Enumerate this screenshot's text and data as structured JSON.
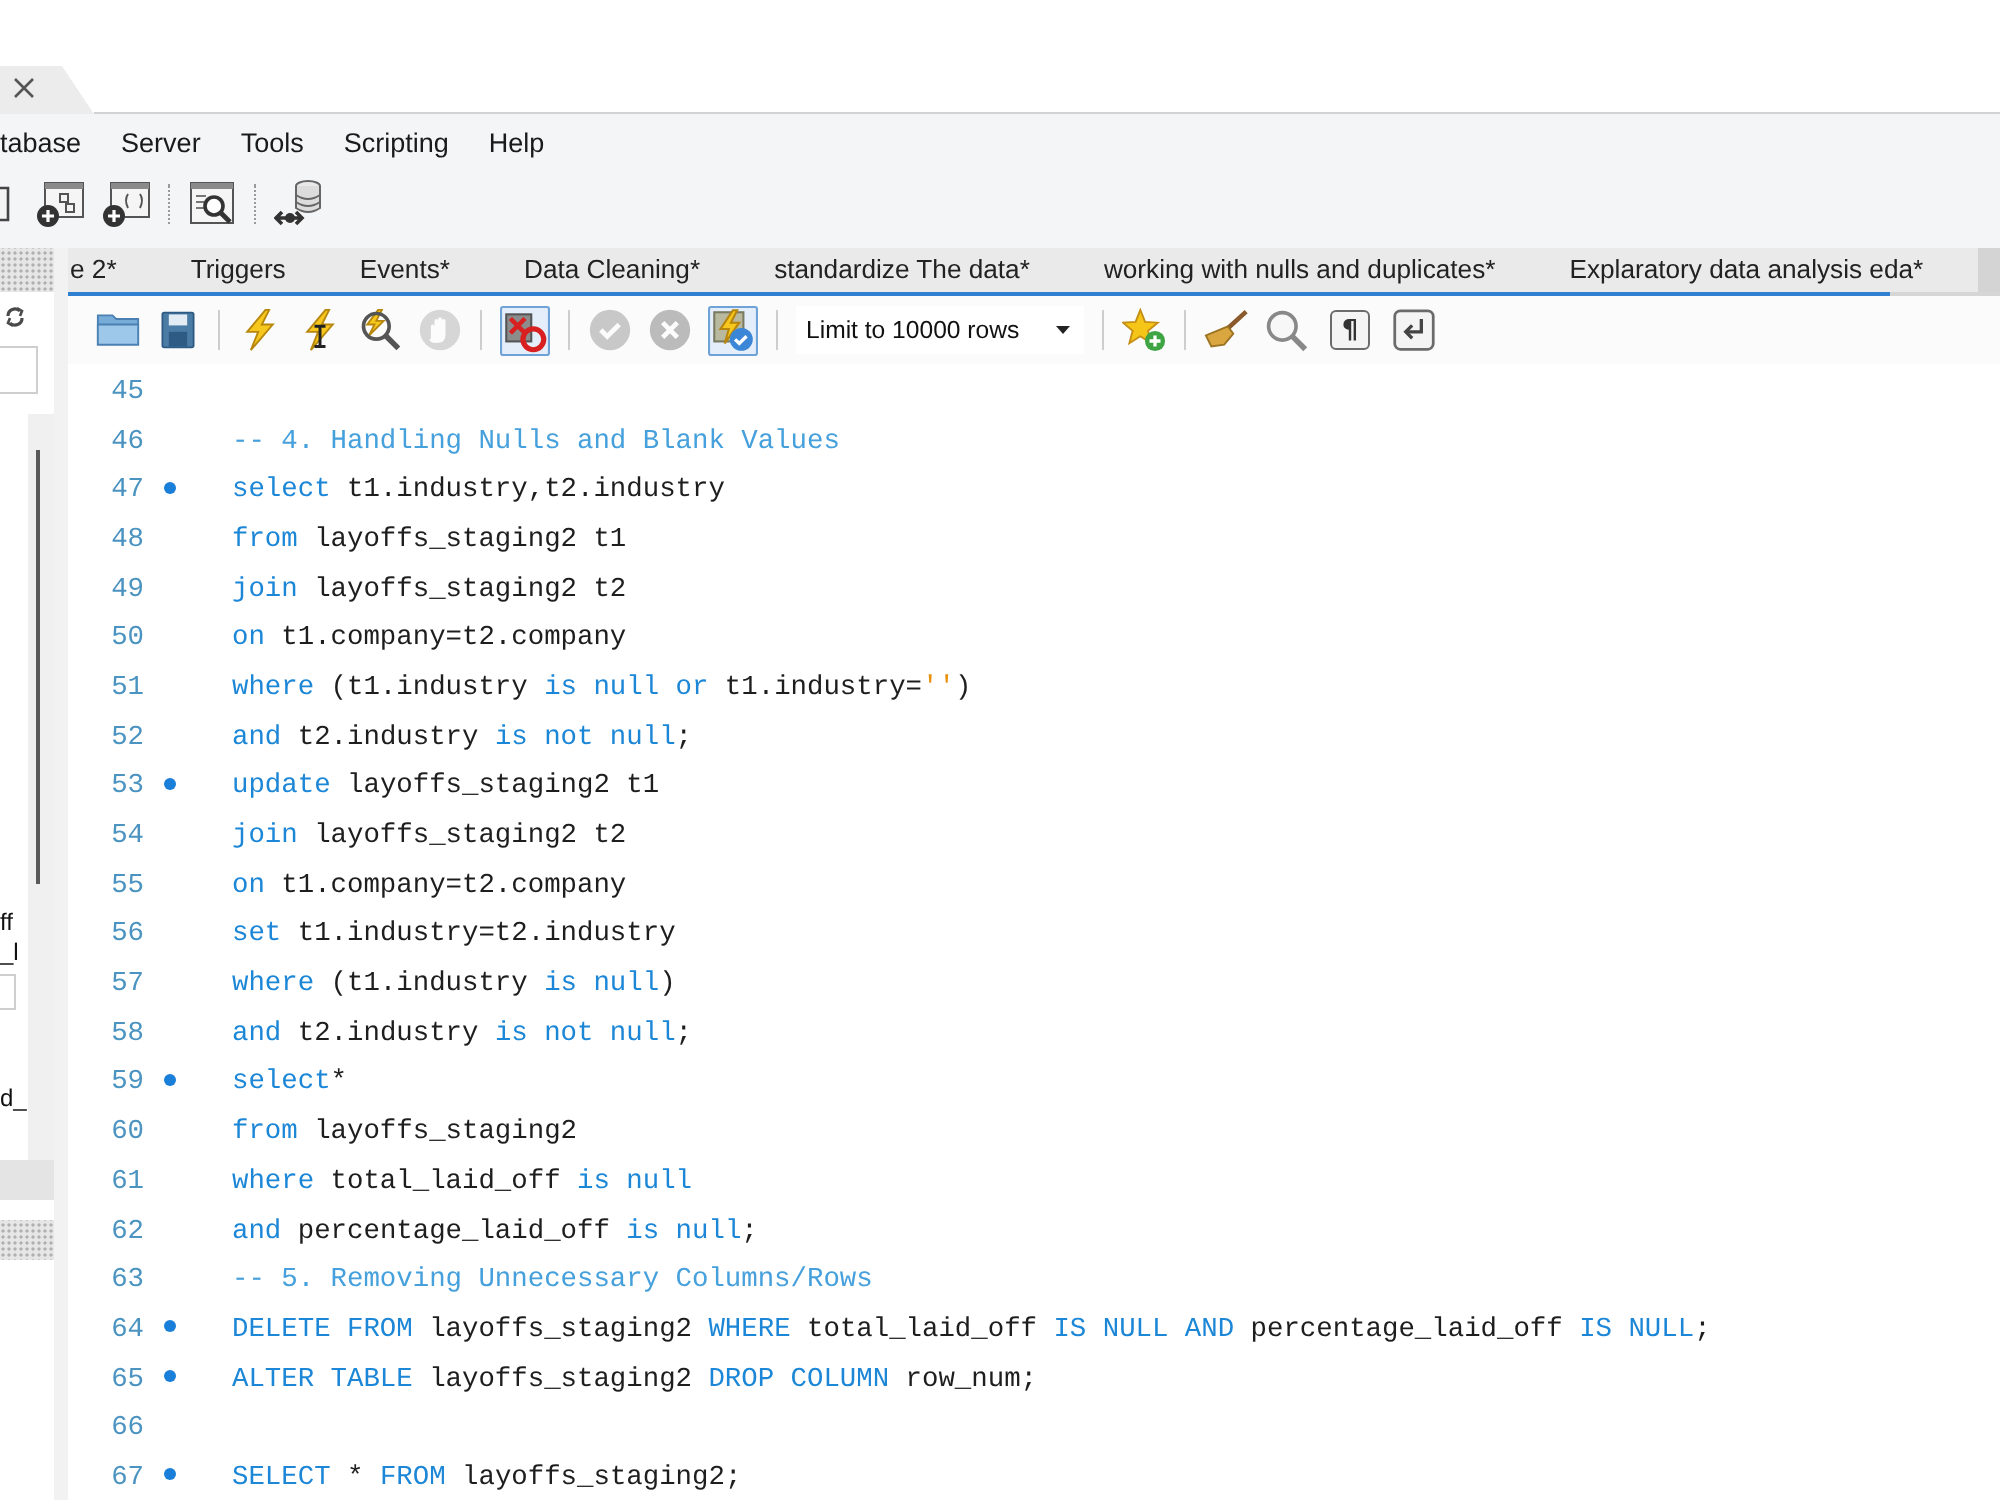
{
  "menu": [
    {
      "label": "tabase"
    },
    {
      "label": "Server"
    },
    {
      "label": "Tools"
    },
    {
      "label": "Scripting"
    },
    {
      "label": "Help"
    }
  ],
  "query_tabs": [
    {
      "label": "e 2*"
    },
    {
      "label": "Triggers"
    },
    {
      "label": "Events*"
    },
    {
      "label": "Data Cleaning*"
    },
    {
      "label": "standardize The data*"
    },
    {
      "label": "working with nulls and duplicates*"
    },
    {
      "label": "Explaratory data analysis eda*"
    }
  ],
  "sidebar": {
    "texts": [
      "ff",
      "_l",
      "d_"
    ]
  },
  "editor_toolbar": {
    "left_groups": [
      [
        {
          "kind": "open",
          "disabled": false,
          "pressed": false
        },
        {
          "kind": "save",
          "disabled": false,
          "pressed": false
        }
      ],
      [
        {
          "kind": "execute",
          "disabled": false,
          "pressed": false
        },
        {
          "kind": "execute_current",
          "disabled": false,
          "pressed": false
        },
        {
          "kind": "explain",
          "disabled": false,
          "pressed": false
        },
        {
          "kind": "stop",
          "disabled": true,
          "pressed": false
        }
      ],
      [
        {
          "kind": "stop_on_error",
          "disabled": false,
          "pressed": true
        }
      ],
      [
        {
          "kind": "commit",
          "disabled": true,
          "pressed": false
        },
        {
          "kind": "rollback",
          "disabled": true,
          "pressed": false
        },
        {
          "kind": "autocommit",
          "disabled": false,
          "pressed": true
        }
      ]
    ],
    "limit_select": {
      "value": "Limit to 10000 rows"
    },
    "right_groups": [
      [
        {
          "kind": "bookmark",
          "disabled": false,
          "pressed": false
        }
      ],
      [
        {
          "kind": "beautify",
          "disabled": false,
          "pressed": false
        },
        {
          "kind": "find",
          "disabled": false,
          "pressed": false
        },
        {
          "kind": "invisibles",
          "label": "¶",
          "disabled": false,
          "pressed": false
        },
        {
          "kind": "wrap",
          "disabled": false,
          "pressed": false
        }
      ]
    ]
  },
  "code_lines": [
    {
      "number": "45",
      "marker": false
    },
    {
      "number": "46",
      "marker": false,
      "tokens": [
        {
          "kind": "comment",
          "text": "-- 4. Handling Nulls and Blank Values"
        }
      ]
    },
    {
      "number": "47",
      "marker": true,
      "tokens": [
        {
          "kind": "keyword",
          "text": "select"
        },
        {
          "kind": "plain",
          "text": " t1.industry,t2.industry"
        }
      ]
    },
    {
      "number": "48",
      "marker": false,
      "tokens": [
        {
          "kind": "keyword",
          "text": "from"
        },
        {
          "kind": "plain",
          "text": " layoffs_staging2 t1"
        }
      ]
    },
    {
      "number": "49",
      "marker": false,
      "tokens": [
        {
          "kind": "keyword",
          "text": "join"
        },
        {
          "kind": "plain",
          "text": " layoffs_staging2 t2"
        }
      ]
    },
    {
      "number": "50",
      "marker": false,
      "tokens": [
        {
          "kind": "keyword",
          "text": "on"
        },
        {
          "kind": "plain",
          "text": " t1.company=t2.company"
        }
      ]
    },
    {
      "number": "51",
      "marker": false,
      "tokens": [
        {
          "kind": "keyword",
          "text": "where"
        },
        {
          "kind": "plain",
          "text": " (t1.industry "
        },
        {
          "kind": "keyword",
          "text": "is null or"
        },
        {
          "kind": "plain",
          "text": " t1.industry="
        },
        {
          "kind": "string",
          "text": "''"
        },
        {
          "kind": "plain",
          "text": ")"
        }
      ]
    },
    {
      "number": "52",
      "marker": false,
      "tokens": [
        {
          "kind": "keyword",
          "text": "and"
        },
        {
          "kind": "plain",
          "text": " t2.industry "
        },
        {
          "kind": "keyword",
          "text": "is not null"
        },
        {
          "kind": "plain",
          "text": ";"
        }
      ]
    },
    {
      "number": "53",
      "marker": true,
      "tokens": [
        {
          "kind": "keyword",
          "text": "update"
        },
        {
          "kind": "plain",
          "text": " layoffs_staging2 t1"
        }
      ]
    },
    {
      "number": "54",
      "marker": false,
      "tokens": [
        {
          "kind": "keyword",
          "text": "join"
        },
        {
          "kind": "plain",
          "text": " layoffs_staging2 t2"
        }
      ]
    },
    {
      "number": "55",
      "marker": false,
      "tokens": [
        {
          "kind": "keyword",
          "text": "on"
        },
        {
          "kind": "plain",
          "text": " t1.company=t2.company"
        }
      ]
    },
    {
      "number": "56",
      "marker": false,
      "tokens": [
        {
          "kind": "keyword",
          "text": "set"
        },
        {
          "kind": "plain",
          "text": " t1.industry=t2.industry"
        }
      ]
    },
    {
      "number": "57",
      "marker": false,
      "tokens": [
        {
          "kind": "keyword",
          "text": "where"
        },
        {
          "kind": "plain",
          "text": " (t1.industry "
        },
        {
          "kind": "keyword",
          "text": "is null"
        },
        {
          "kind": "plain",
          "text": ")"
        }
      ]
    },
    {
      "number": "58",
      "marker": false,
      "tokens": [
        {
          "kind": "keyword",
          "text": "and"
        },
        {
          "kind": "plain",
          "text": " t2.industry "
        },
        {
          "kind": "keyword",
          "text": "is not null"
        },
        {
          "kind": "plain",
          "text": ";"
        }
      ]
    },
    {
      "number": "59",
      "marker": true,
      "tokens": [
        {
          "kind": "keyword",
          "text": "select"
        },
        {
          "kind": "plain",
          "text": "*"
        }
      ]
    },
    {
      "number": "60",
      "marker": false,
      "tokens": [
        {
          "kind": "keyword",
          "text": "from"
        },
        {
          "kind": "plain",
          "text": " layoffs_staging2"
        }
      ]
    },
    {
      "number": "61",
      "marker": false,
      "tokens": [
        {
          "kind": "keyword",
          "text": "where"
        },
        {
          "kind": "plain",
          "text": " total_laid_off "
        },
        {
          "kind": "keyword",
          "text": "is null"
        }
      ]
    },
    {
      "number": "62",
      "marker": false,
      "tokens": [
        {
          "kind": "keyword",
          "text": "and"
        },
        {
          "kind": "plain",
          "text": " percentage_laid_off "
        },
        {
          "kind": "keyword",
          "text": "is null"
        },
        {
          "kind": "plain",
          "text": ";"
        }
      ]
    },
    {
      "number": "63",
      "marker": false,
      "tokens": [
        {
          "kind": "comment",
          "text": "-- 5. Removing Unnecessary Columns/Rows"
        }
      ]
    },
    {
      "number": "64",
      "marker": true,
      "tokens": [
        {
          "kind": "keyword",
          "text": "DELETE FROM"
        },
        {
          "kind": "plain",
          "text": " layoffs_staging2 "
        },
        {
          "kind": "keyword",
          "text": "WHERE"
        },
        {
          "kind": "plain",
          "text": " total_laid_off "
        },
        {
          "kind": "keyword",
          "text": "IS NULL AND"
        },
        {
          "kind": "plain",
          "text": " percentage_laid_off "
        },
        {
          "kind": "keyword",
          "text": "IS NULL"
        },
        {
          "kind": "plain",
          "text": ";"
        }
      ]
    },
    {
      "number": "65",
      "marker": true,
      "tokens": [
        {
          "kind": "keyword",
          "text": "ALTER TABLE"
        },
        {
          "kind": "plain",
          "text": " layoffs_staging2 "
        },
        {
          "kind": "keyword",
          "text": "DROP COLUMN"
        },
        {
          "kind": "plain",
          "text": " row_num;"
        }
      ]
    },
    {
      "number": "66",
      "marker": false
    },
    {
      "number": "67",
      "marker": true,
      "tokens": [
        {
          "kind": "keyword",
          "text": "SELECT"
        },
        {
          "kind": "plain",
          "text": " * "
        },
        {
          "kind": "keyword",
          "text": "FROM"
        },
        {
          "kind": "plain",
          "text": " layoffs_staging2;"
        }
      ]
    }
  ]
}
